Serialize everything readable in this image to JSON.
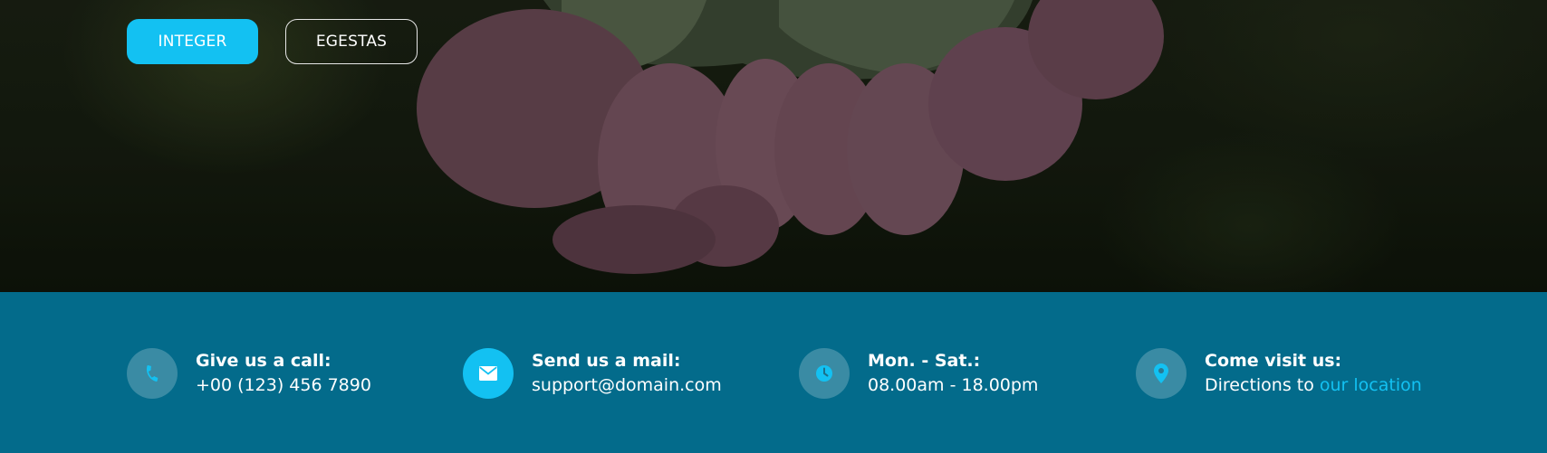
{
  "hero": {
    "buttons": {
      "primary_label": "INTEGER",
      "secondary_label": "EGESTAS"
    }
  },
  "contact": {
    "items": [
      {
        "icon": "phone-icon",
        "title": "Give us a call:",
        "value": "+00 (123) 456 7890"
      },
      {
        "icon": "envelope-icon",
        "title": "Send us a mail:",
        "value": "support@domain.com"
      },
      {
        "icon": "clock-icon",
        "title": "Mon. - Sat.:",
        "value": "08.00am - 18.00pm"
      },
      {
        "icon": "map-pin-icon",
        "title": "Come visit us:",
        "value_prefix": "Directions to ",
        "link_text": "our location"
      }
    ]
  },
  "colors": {
    "accent": "#13c1f2",
    "footer_bg": "#036b8b",
    "text": "#ffffff"
  }
}
